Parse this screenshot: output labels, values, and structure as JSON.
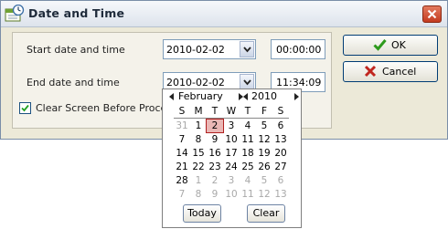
{
  "window": {
    "title": "Date and Time",
    "app_icon": "calendar-clock-icon",
    "close_icon": "close-icon"
  },
  "start": {
    "label": "Start date and time",
    "date": "2010-02-02",
    "time": "00:00:00"
  },
  "end": {
    "label": "End date and time",
    "date": "2010-02-02",
    "time": "11:34:09"
  },
  "clear_screen": {
    "label": "Clear Screen Before Proce",
    "checked": true
  },
  "buttons": {
    "ok": "OK",
    "cancel": "Cancel",
    "ok_icon": "checkmark-icon",
    "cancel_icon": "x-icon"
  },
  "colors": {
    "ok_icon": "#2d9a1c",
    "cancel_icon": "#c0261f",
    "selected_day_bg": "#eab7b5",
    "close_button": "#d1593a"
  },
  "calendar": {
    "month": "February",
    "year": "2010",
    "weekdays": [
      "S",
      "M",
      "T",
      "W",
      "T",
      "F",
      "S"
    ],
    "weeks": [
      [
        "31",
        "1",
        "2",
        "3",
        "4",
        "5",
        "6"
      ],
      [
        "7",
        "8",
        "9",
        "10",
        "11",
        "12",
        "13"
      ],
      [
        "14",
        "15",
        "16",
        "17",
        "18",
        "19",
        "20"
      ],
      [
        "21",
        "22",
        "23",
        "24",
        "25",
        "26",
        "27"
      ],
      [
        "28",
        "1",
        "2",
        "3",
        "4",
        "5",
        "6"
      ],
      [
        "7",
        "8",
        "9",
        "10",
        "11",
        "12",
        "13"
      ]
    ],
    "selected_day": "2",
    "today_label": "Today",
    "clear_label": "Clear"
  }
}
